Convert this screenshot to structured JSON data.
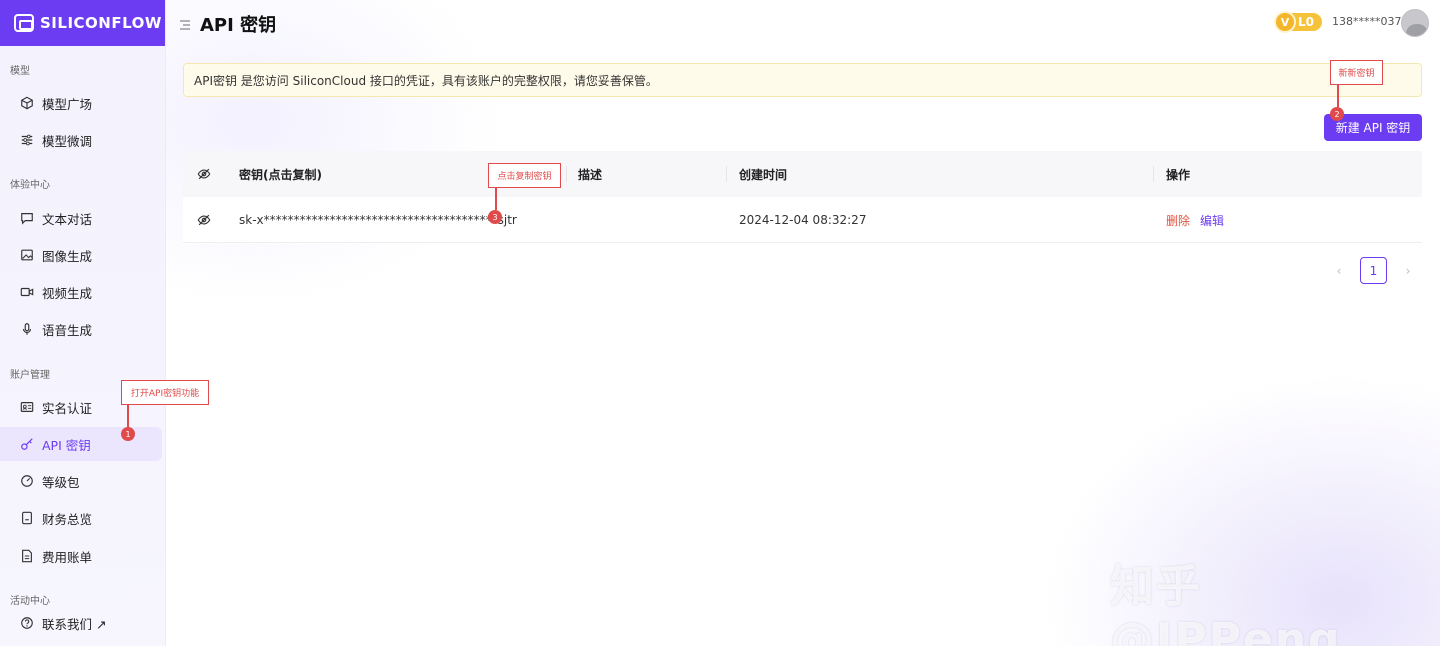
{
  "brand": {
    "name": "SILICONFLOW"
  },
  "header": {
    "title": "API 密钥",
    "level": "L0",
    "level_icon": "V",
    "username": "138*****037"
  },
  "sidebar": {
    "groups": [
      {
        "label": "模型",
        "items": [
          {
            "label": "模型广场",
            "icon": "cube-icon"
          },
          {
            "label": "模型微调",
            "icon": "sliders-icon"
          }
        ]
      },
      {
        "label": "体验中心",
        "items": [
          {
            "label": "文本对话",
            "icon": "chat-icon"
          },
          {
            "label": "图像生成",
            "icon": "image-icon"
          },
          {
            "label": "视频生成",
            "icon": "video-icon"
          },
          {
            "label": "语音生成",
            "icon": "mic-icon"
          }
        ]
      },
      {
        "label": "账户管理",
        "items": [
          {
            "label": "实名认证",
            "icon": "id-card-icon"
          },
          {
            "label": "API 密钥",
            "icon": "key-icon",
            "active": true
          },
          {
            "label": "等级包",
            "icon": "gauge-icon"
          },
          {
            "label": "财务总览",
            "icon": "wallet-icon"
          },
          {
            "label": "费用账单",
            "icon": "bill-icon"
          }
        ]
      },
      {
        "label": "活动中心",
        "items": [
          {
            "label": "联系我们 ↗",
            "icon": "help-icon"
          }
        ]
      }
    ]
  },
  "notice": {
    "text": "API密钥 是您访问 SiliconCloud 接口的凭证，具有该账户的完整权限，请您妥善保管。"
  },
  "actions": {
    "new_key": "新建 API 密钥"
  },
  "table": {
    "columns": {
      "key": "密钥(点击复制)",
      "description": "描述",
      "created": "创建时间",
      "operations": "操作"
    },
    "rows": [
      {
        "key": "sk-x***************************************sjtr",
        "description": "",
        "created": "2024-12-04 08:32:27",
        "delete": "删除",
        "edit": "编辑"
      }
    ]
  },
  "pagination": {
    "current": "1"
  },
  "annotations": {
    "open_api_key": {
      "text": "打开API密钥功能",
      "step": "1"
    },
    "new_key": {
      "text": "新新密钥",
      "step": "2"
    },
    "copy_key": {
      "text": "点击复制密钥",
      "step": "3"
    }
  },
  "watermark": "知乎 @JPPeng",
  "colors": {
    "primary": "#6b3cf2",
    "danger": "#e0513f",
    "annotation": "#e04a4a",
    "level_badge": "#f6c23a"
  }
}
